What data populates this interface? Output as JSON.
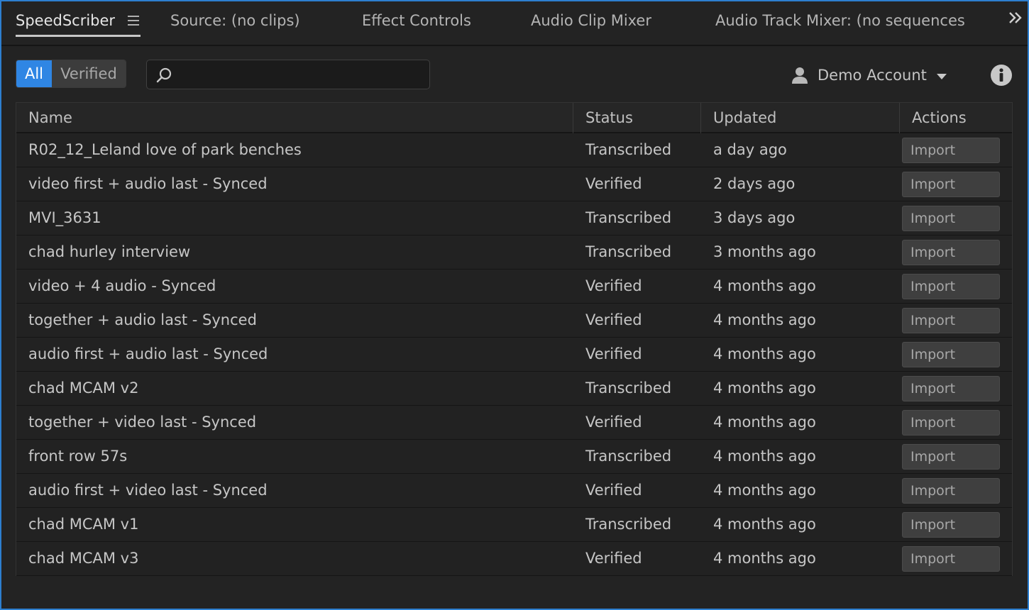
{
  "tabs": [
    {
      "label": "SpeedScriber",
      "active": true
    },
    {
      "label": "Source: (no clips)",
      "active": false
    },
    {
      "label": "Effect Controls",
      "active": false
    },
    {
      "label": "Audio Clip Mixer",
      "active": false
    },
    {
      "label": "Audio Track Mixer: (no sequences",
      "active": false
    }
  ],
  "overflow_icon": "double-chevron-right-icon",
  "filter": {
    "all_label": "All",
    "verified_label": "Verified",
    "selected": "All",
    "accent": "#2f86e4"
  },
  "search": {
    "value": "",
    "placeholder": "",
    "icon": "search-icon"
  },
  "account": {
    "label": "Demo Account",
    "icon": "user-icon",
    "caret": "caret-down-icon"
  },
  "info_icon": "info-icon",
  "table": {
    "columns": [
      "Name",
      "Status",
      "Updated",
      "Actions"
    ],
    "rows": [
      {
        "name": "R02_12_Leland love of park benches",
        "status": "Transcribed",
        "updated": "a day ago",
        "action": "Import"
      },
      {
        "name": "video first + audio last - Synced",
        "status": "Verified",
        "updated": "2 days ago",
        "action": "Import"
      },
      {
        "name": "MVI_3631",
        "status": "Transcribed",
        "updated": "3 days ago",
        "action": "Import"
      },
      {
        "name": "chad hurley interview",
        "status": "Transcribed",
        "updated": "3 months ago",
        "action": "Import"
      },
      {
        "name": "video + 4 audio - Synced",
        "status": "Verified",
        "updated": "4 months ago",
        "action": "Import"
      },
      {
        "name": "together + audio last - Synced",
        "status": "Verified",
        "updated": "4 months ago",
        "action": "Import"
      },
      {
        "name": "audio first + audio last - Synced",
        "status": "Verified",
        "updated": "4 months ago",
        "action": "Import"
      },
      {
        "name": "chad MCAM v2",
        "status": "Transcribed",
        "updated": "4 months ago",
        "action": "Import"
      },
      {
        "name": "together + video last - Synced",
        "status": "Verified",
        "updated": "4 months ago",
        "action": "Import"
      },
      {
        "name": "front row 57s",
        "status": "Transcribed",
        "updated": "4 months ago",
        "action": "Import"
      },
      {
        "name": "audio first + video last - Synced",
        "status": "Verified",
        "updated": "4 months ago",
        "action": "Import"
      },
      {
        "name": "chad MCAM v1",
        "status": "Transcribed",
        "updated": "4 months ago",
        "action": "Import"
      },
      {
        "name": "chad MCAM v3",
        "status": "Verified",
        "updated": "4 months ago",
        "action": "Import"
      }
    ]
  }
}
